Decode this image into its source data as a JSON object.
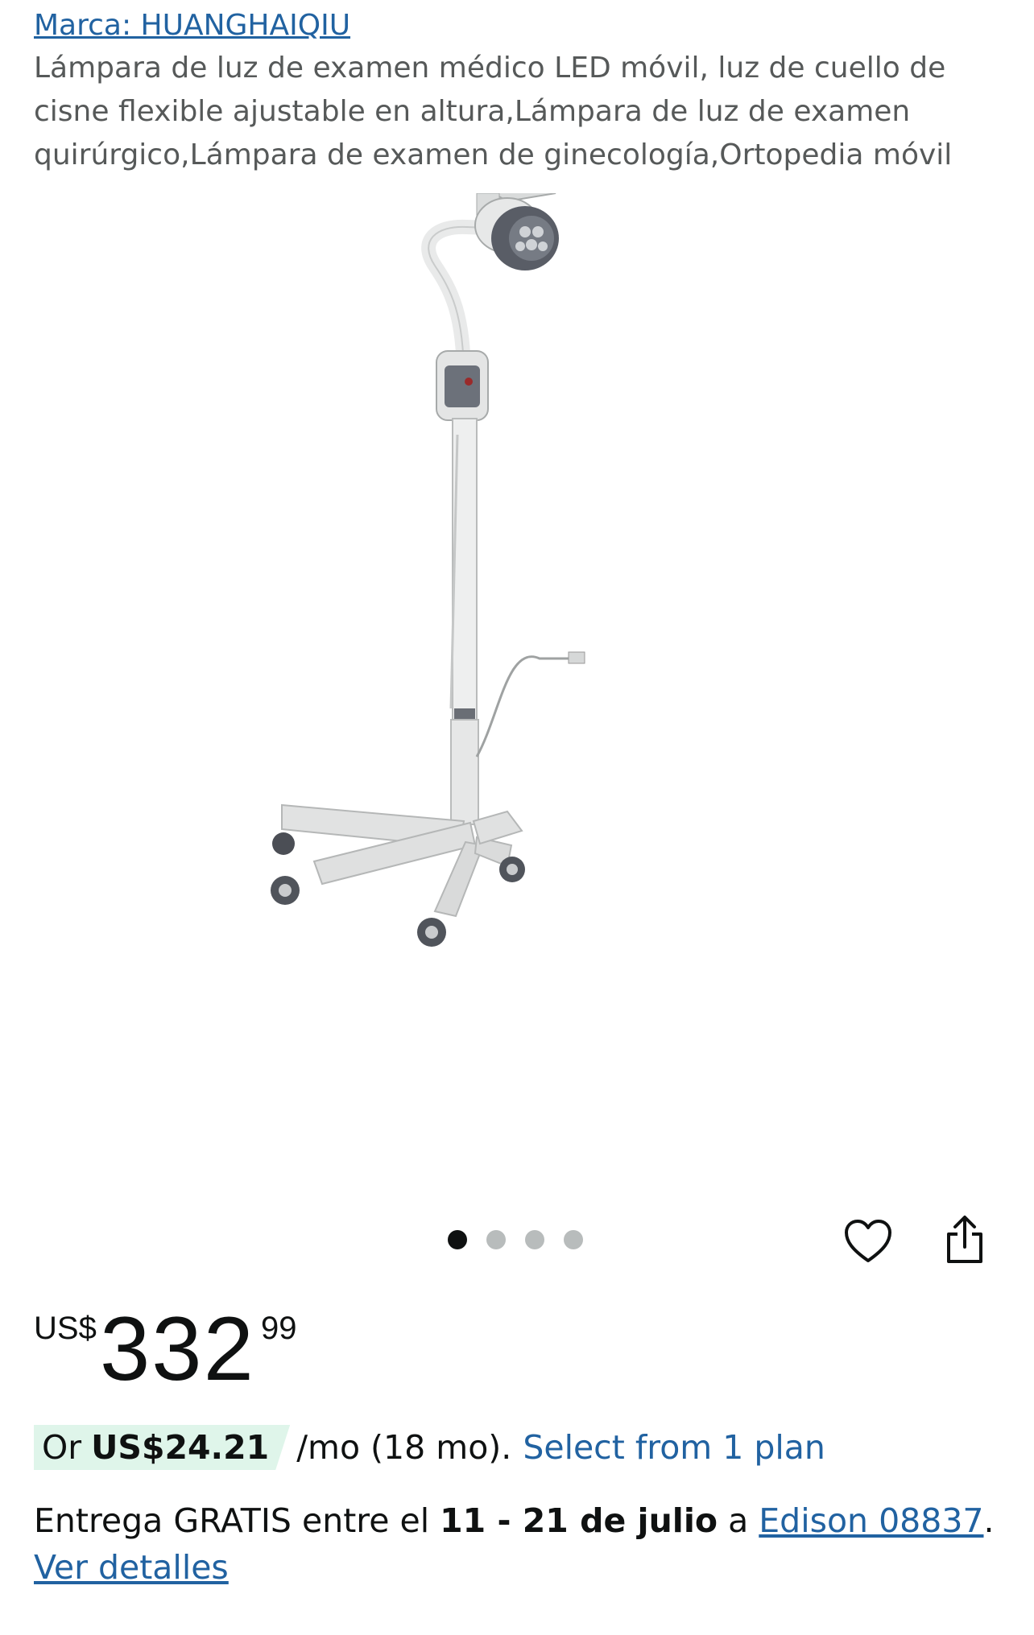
{
  "brand": {
    "label": "Marca: HUANGHAIQIU"
  },
  "product": {
    "title": "Lámpara de luz de examen médico LED móvil, luz de cuello de cisne flexible ajustable en altura,Lámpara de luz de examen quirúrgico,Lámpara de examen de ginecología,Ortopedia móvil",
    "image_icon": "medical-exam-lamp-image"
  },
  "carousel": {
    "count": 4,
    "active_index": 0
  },
  "actions": {
    "favorite_icon": "heart-icon",
    "share_icon": "share-icon"
  },
  "price": {
    "currency": "US$",
    "whole": "332",
    "fraction": "99"
  },
  "installment": {
    "or": "Or",
    "amount": "US$24.21",
    "per_month": "/mo (18 mo).",
    "link": "Select from 1 plan"
  },
  "delivery": {
    "prefix": "Entrega GRATIS entre el",
    "dates": "11 - 21 de julio",
    "to": "a",
    "location": "Edison 08837",
    "period": ".",
    "details_link": "Ver detalles"
  },
  "colors": {
    "link": "#2162a1",
    "installment_bg": "#dff5ea",
    "text": "#0f1111",
    "title": "#565959"
  }
}
